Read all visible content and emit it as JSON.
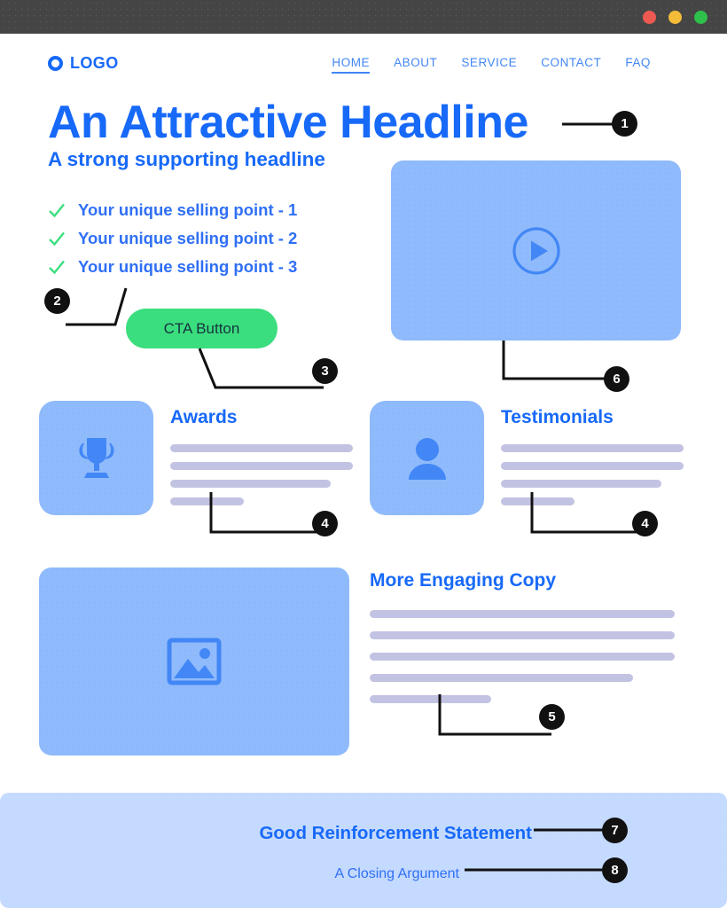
{
  "window": {
    "dots": [
      {
        "name": "close",
        "color": "#ee5a52"
      },
      {
        "name": "minimize",
        "color": "#f5bc3a"
      },
      {
        "name": "maximize",
        "color": "#2fc04b"
      }
    ]
  },
  "header": {
    "logo_text": "LOGO",
    "logo_icon": "circle-ring-icon",
    "nav": [
      {
        "label": "HOME",
        "active": true
      },
      {
        "label": "ABOUT",
        "active": false
      },
      {
        "label": "SERVICE",
        "active": false
      },
      {
        "label": "CONTACT",
        "active": false
      },
      {
        "label": "FAQ",
        "active": false
      }
    ]
  },
  "hero": {
    "headline": "An Attractive Headline",
    "subheadline": "A strong supporting headline",
    "usps": [
      "Your unique selling point - 1",
      "Your unique selling point - 2",
      "Your unique selling point - 3"
    ],
    "cta_label": "CTA Button",
    "video_icon": "play-circle-icon"
  },
  "features": [
    {
      "title": "Awards",
      "icon": "trophy-icon",
      "bars": [
        100,
        100,
        88,
        40
      ]
    },
    {
      "title": "Testimonials",
      "icon": "person-icon",
      "bars": [
        100,
        100,
        88,
        40
      ]
    }
  ],
  "copy_section": {
    "title": "More Engaging Copy",
    "image_icon": "image-placeholder-icon",
    "bars": [
      100,
      100,
      100,
      86,
      40
    ]
  },
  "footer": {
    "primary": "Good Reinforcement Statement",
    "secondary": "A Closing Argument"
  },
  "callouts": [
    {
      "number": "1",
      "target": "headline"
    },
    {
      "number": "2",
      "target": "usp-list"
    },
    {
      "number": "3",
      "target": "cta-button"
    },
    {
      "number": "4",
      "target": "awards-bars"
    },
    {
      "number": "4",
      "target": "testimonials-bars"
    },
    {
      "number": "5",
      "target": "copy-bars"
    },
    {
      "number": "6",
      "target": "video-placeholder"
    },
    {
      "number": "7",
      "target": "footer-primary"
    },
    {
      "number": "8",
      "target": "footer-secondary"
    }
  ],
  "colors": {
    "brand_blue": "#1769f8",
    "nav_blue": "#4287f5",
    "cta_green": "#3bde7e",
    "check_green": "#3bde7e",
    "placeholder_blue": "#8fbafc",
    "bar_lavender": "#c2c2e2",
    "footer_blue": "#c5daff",
    "callout_black": "#111111",
    "titlebar_gray": "#454545"
  }
}
